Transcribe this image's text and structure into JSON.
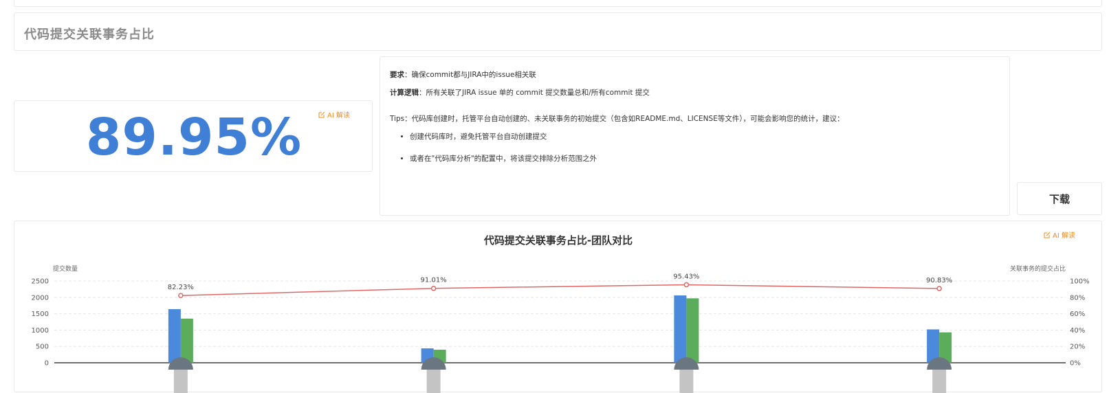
{
  "header": {
    "title": "代码提交关联事务占比"
  },
  "metric": {
    "value": "89.95%",
    "ai_label": "AI 解读"
  },
  "description": {
    "req_label": "要求",
    "req_text": "：确保commit都与JIRA中的issue相关联",
    "logic_label": "计算逻辑",
    "logic_text": "：所有关联了JIRA issue 单的 commit 提交数量总和/所有commit 提交",
    "tips": "Tips：代码库创建时，托管平台自动创建的、未关联事务的初始提交（包含如README.md、LICENSE等文件），可能会影响您的统计，建议：",
    "bullets": [
      "创建代码库时，避免托管平台自动创建提交",
      "或者在\"代码库分析\"的配置中，将该提交排除分析范围之外"
    ]
  },
  "download": {
    "label": "下载"
  },
  "colors": {
    "bar1": "#4a89dc",
    "bar2": "#5bad5b",
    "line": "#e06666",
    "accent": "#f08a24",
    "metric": "#3f7fd6"
  },
  "chart_data": {
    "type": "bar",
    "title": "代码提交关联事务占比-团队对比",
    "ai_label": "AI 解读",
    "ylabel_left": "提交数量",
    "ylabel_right": "关联事务的提交占比",
    "ylim_left": [
      0,
      2500
    ],
    "ylim_right": [
      0,
      100
    ],
    "left_ticks": [
      "0",
      "500",
      "1000",
      "1500",
      "2000",
      "2500"
    ],
    "right_ticks": [
      "0%",
      "20%",
      "40%",
      "60%",
      "80%",
      "100%"
    ],
    "categories": [
      "",
      "",
      "",
      ""
    ],
    "series": [
      {
        "values": [
          1640,
          440,
          2060,
          1020
        ]
      },
      {
        "values": [
          1350,
          400,
          1970,
          930
        ]
      }
    ],
    "line": {
      "values": [
        82.23,
        91.01,
        95.43,
        90.83
      ],
      "labels": [
        "82.23%",
        "91.01%",
        "95.43%",
        "90.83%"
      ]
    },
    "grid": true
  }
}
